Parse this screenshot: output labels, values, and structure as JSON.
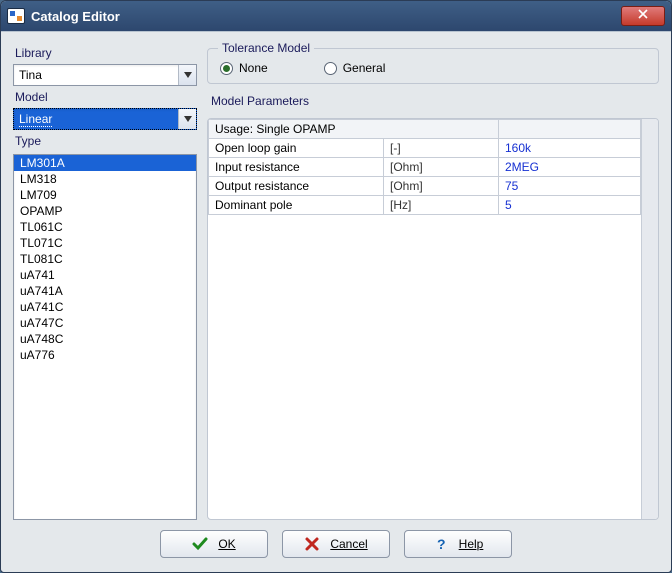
{
  "window": {
    "title": "Catalog Editor"
  },
  "left": {
    "library_label": "Library",
    "library_value": "Tina",
    "model_label": "Model",
    "model_value": "Linear",
    "type_label": "Type",
    "types": [
      "LM301A",
      "LM318",
      "LM709",
      "OPAMP",
      "TL061C",
      "TL071C",
      "TL081C",
      "uA741",
      "uA741A",
      "uA741C",
      "uA747C",
      "uA748C",
      "uA776"
    ],
    "type_selected": "LM301A"
  },
  "right": {
    "tolerance_legend": "Tolerance Model",
    "radio_none": "None",
    "radio_general": "General",
    "tolerance_selected": "None",
    "params_label": "Model Parameters",
    "usage_header": "Usage: Single OPAMP",
    "rows": [
      {
        "name": "Open loop gain",
        "unit": "[-]",
        "value": "160k"
      },
      {
        "name": "Input resistance",
        "unit": "[Ohm]",
        "value": "2MEG"
      },
      {
        "name": "Output resistance",
        "unit": "[Ohm]",
        "value": "75"
      },
      {
        "name": "Dominant pole",
        "unit": "[Hz]",
        "value": "5"
      }
    ]
  },
  "buttons": {
    "ok": "OK",
    "cancel": "Cancel",
    "help": "Help"
  }
}
